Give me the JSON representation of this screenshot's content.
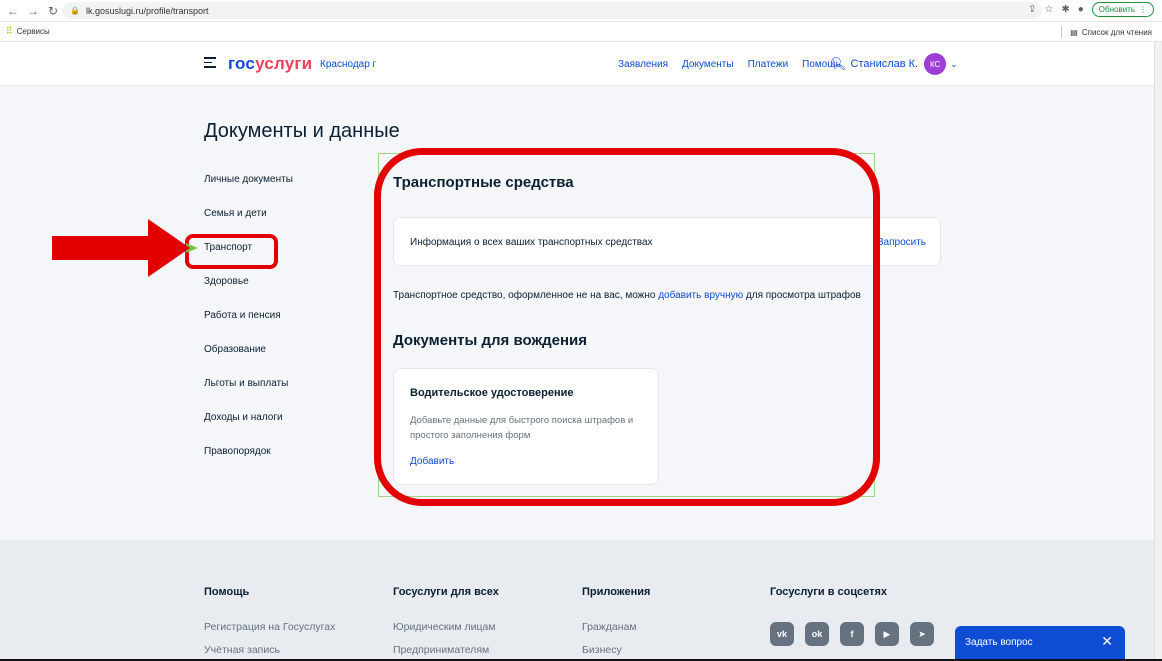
{
  "browser": {
    "url": "lk.gosuslugi.ru/profile/transport",
    "update_label": "Обновить",
    "bookmarks_apps": "Сервисы",
    "reading_list": "Список для чтения"
  },
  "header": {
    "logo_part1": "гос",
    "logo_part2": "услуги",
    "city": "Краснодар г",
    "nav": [
      "Заявления",
      "Документы",
      "Платежи",
      "Помощь"
    ],
    "user_name": "Станислав К.",
    "avatar_initials": "КС"
  },
  "page": {
    "title": "Документы и данные"
  },
  "sidebar": {
    "items": [
      {
        "label": "Личные документы"
      },
      {
        "label": "Семья и дети"
      },
      {
        "label": "Транспорт"
      },
      {
        "label": "Здоровье"
      },
      {
        "label": "Работа и пенсия"
      },
      {
        "label": "Образование"
      },
      {
        "label": "Льготы и выплаты"
      },
      {
        "label": "Доходы и налоги"
      },
      {
        "label": "Правопорядок"
      }
    ]
  },
  "transport": {
    "title": "Транспортные средства",
    "card_text": "Информация о всех ваших транспортных средствах",
    "card_action": "Запросить",
    "note_before": "Транспортное средство, оформленное не на вас, можно ",
    "note_link": "добавить вручную",
    "note_after": " для просмотра штрафов"
  },
  "driving": {
    "title": "Документы для вождения",
    "card_title": "Водительское удостоверение",
    "card_desc": "Добавьте данные для быстрого поиска штрафов и простого заполнения форм",
    "card_action": "Добавить"
  },
  "footer": {
    "columns": [
      {
        "heading": "Помощь",
        "links": [
          "Регистрация на Госуслугах",
          "Учётная запись"
        ]
      },
      {
        "heading": "Госуслуги для всех",
        "links": [
          "Юридическим лицам",
          "Предпринимателям"
        ]
      },
      {
        "heading": "Приложения",
        "links": [
          "Гражданам",
          "Бизнесу"
        ]
      },
      {
        "heading": "Госуслуги в соцсетях",
        "links": []
      }
    ],
    "socials": [
      "vk",
      "ok",
      "f",
      "youtube",
      "telegram"
    ]
  },
  "chat": {
    "label": "Задать вопрос",
    "close": "✕"
  },
  "colors": {
    "brand_blue": "#0d4cd3",
    "brand_red": "#ee3f58",
    "annotation_red": "#e30000",
    "annotation_green": "#7cc242",
    "avatar_purple": "#9d3fd6"
  }
}
